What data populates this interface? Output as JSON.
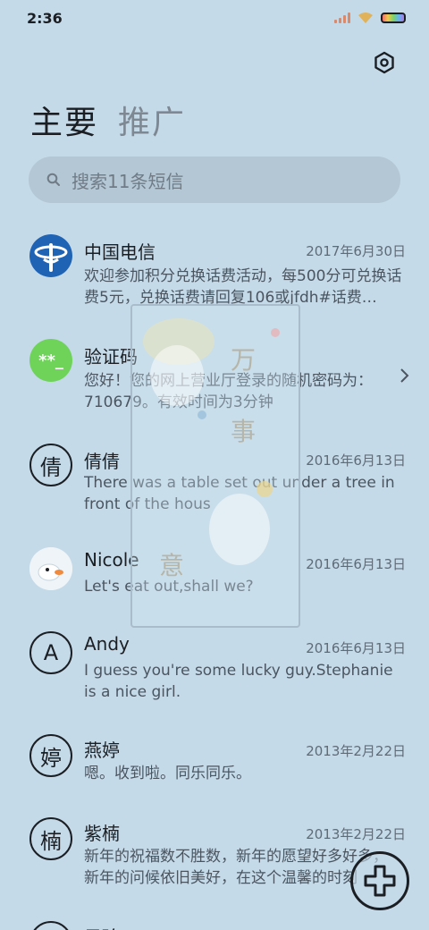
{
  "status": {
    "time": "2:36"
  },
  "tabs": {
    "primary": "主要",
    "promo": "推广"
  },
  "search": {
    "placeholder": "搜索11条短信"
  },
  "conversations": [
    {
      "name": "中国电信",
      "date": "2017年6月30日",
      "preview": "欢迎参加积分兑换话费活动，每500分可兑换话费5元，兑换话费请回复106或jfdh#话费…",
      "avatar_type": "telecom-logo"
    },
    {
      "name": "验证码",
      "date": "",
      "preview": "您好！您的网上营业厅登录的随机密码为：710679。有效时间为3分钟",
      "avatar_type": "code-badge",
      "avatar_text": "**_"
    },
    {
      "name": "倩倩",
      "date": "2016年6月13日",
      "preview": "There was a table set out under a tree in front of the hous",
      "avatar_type": "letter",
      "avatar_text": "倩"
    },
    {
      "name": "Nicole",
      "date": "2016年6月13日",
      "preview": "Let's eat out,shall we?",
      "avatar_type": "photo"
    },
    {
      "name": "Andy",
      "date": "2016年6月13日",
      "preview": "I guess you're some lucky guy.Stephanie is a nice girl.",
      "avatar_type": "letter",
      "avatar_text": "A"
    },
    {
      "name": "燕婷",
      "date": "2013年2月22日",
      "preview": "嗯。收到啦。同乐同乐。",
      "avatar_type": "letter",
      "avatar_text": "婷"
    },
    {
      "name": "紫楠",
      "date": "2013年2月22日",
      "preview": "新年的祝福数不胜数，新年的愿望好多好多，新年的问候依旧美好，在这个温馨的时刻",
      "avatar_type": "letter",
      "avatar_text": "楠"
    },
    {
      "name": "子玲",
      "date": "",
      "preview": "",
      "avatar_type": "letter",
      "avatar_text": ""
    }
  ],
  "colors": {
    "background": "#c5dae8",
    "telecom_blue": "#1f63b5",
    "code_green": "#6fd35a"
  }
}
